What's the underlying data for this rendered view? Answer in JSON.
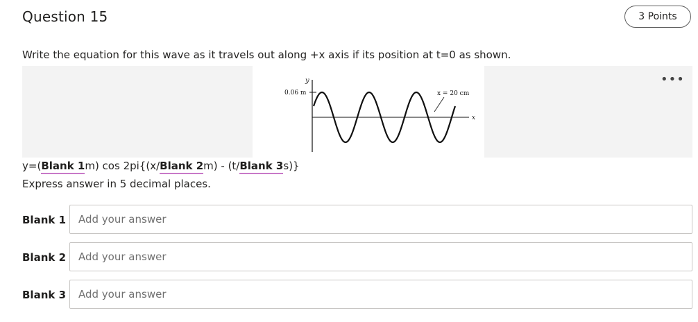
{
  "question": {
    "title": "Question 15",
    "points": "3 Points",
    "text": "Write the equation for this wave as it travels out along +x axis if its position at t=0 as shown."
  },
  "figure": {
    "y_axis_label": "y",
    "x_axis_label": "x",
    "amplitude_label": "0.06 m",
    "wavelength_label": "x = 20 cm"
  },
  "more_options_glyph": "•••",
  "equation": {
    "prefix": "y=(",
    "blank1": "Blank 1",
    "after1": "m) cos 2pi{(x/",
    "blank2": "Blank 2",
    "after2": "m) - (t/",
    "blank3": "Blank 3",
    "after3": "s)}"
  },
  "instructions": "Express answer in 5 decimal places.",
  "blanks": [
    {
      "label": "Blank 1",
      "placeholder": "Add your answer",
      "value": ""
    },
    {
      "label": "Blank 2",
      "placeholder": "Add your answer",
      "value": ""
    },
    {
      "label": "Blank 3",
      "placeholder": "Add your answer",
      "value": ""
    }
  ]
}
